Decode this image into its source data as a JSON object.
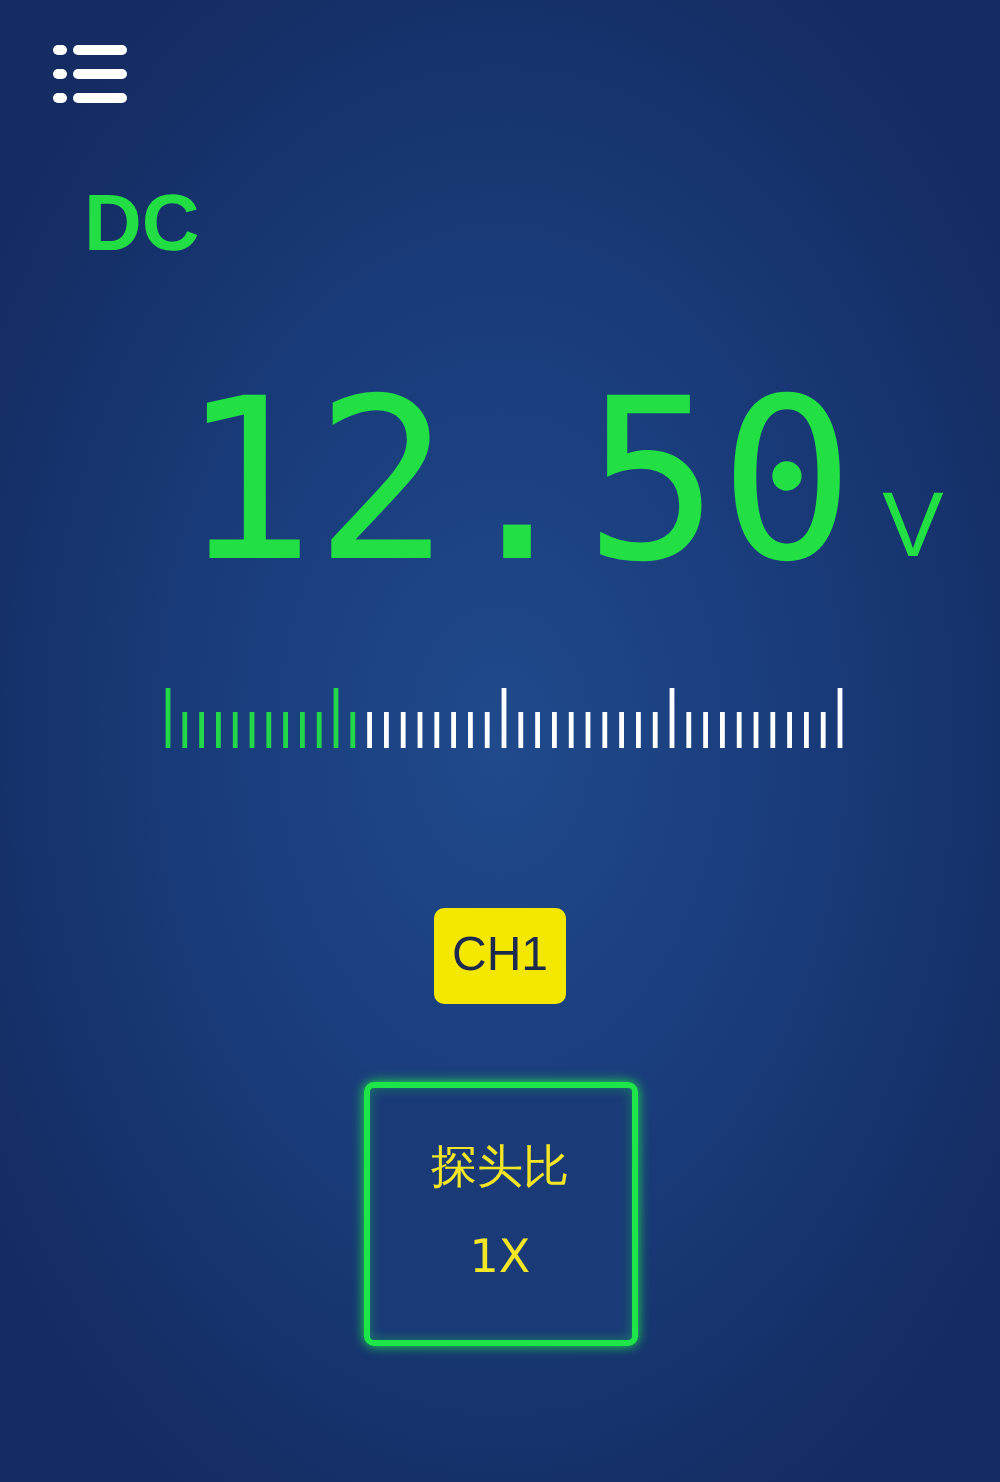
{
  "mode": "DC",
  "reading": {
    "value": "12.50",
    "unit": "V"
  },
  "scale": {
    "level": 0.28
  },
  "channel": "CH1",
  "probe_ratio": {
    "label": "探头比",
    "value": "1X"
  }
}
